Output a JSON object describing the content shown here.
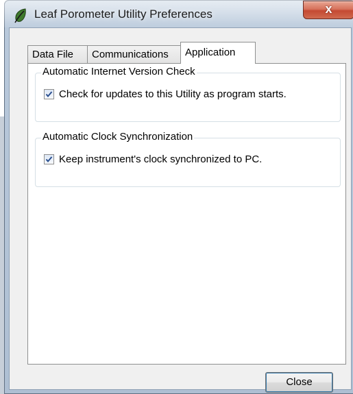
{
  "window": {
    "title": "Leaf Porometer Utility Preferences",
    "close_glyph": "x",
    "icon": "leaf-icon"
  },
  "tabs": [
    {
      "label": "Data File"
    },
    {
      "label": "Communications"
    },
    {
      "label": "Application"
    }
  ],
  "active_tab": "Application",
  "groups": [
    {
      "legend": "Automatic Internet Version Check",
      "checkbox_label": "Check for updates to this Utility as program starts.",
      "checked": true
    },
    {
      "legend": "Automatic Clock Synchronization",
      "checkbox_label": "Keep instrument's clock synchronized to PC.",
      "checked": true
    }
  ],
  "buttons": {
    "close_label": "Close"
  },
  "colors": {
    "accent": "#3c7fb1",
    "close_button": "#c44a33",
    "leaf": "#3f7a2d"
  }
}
